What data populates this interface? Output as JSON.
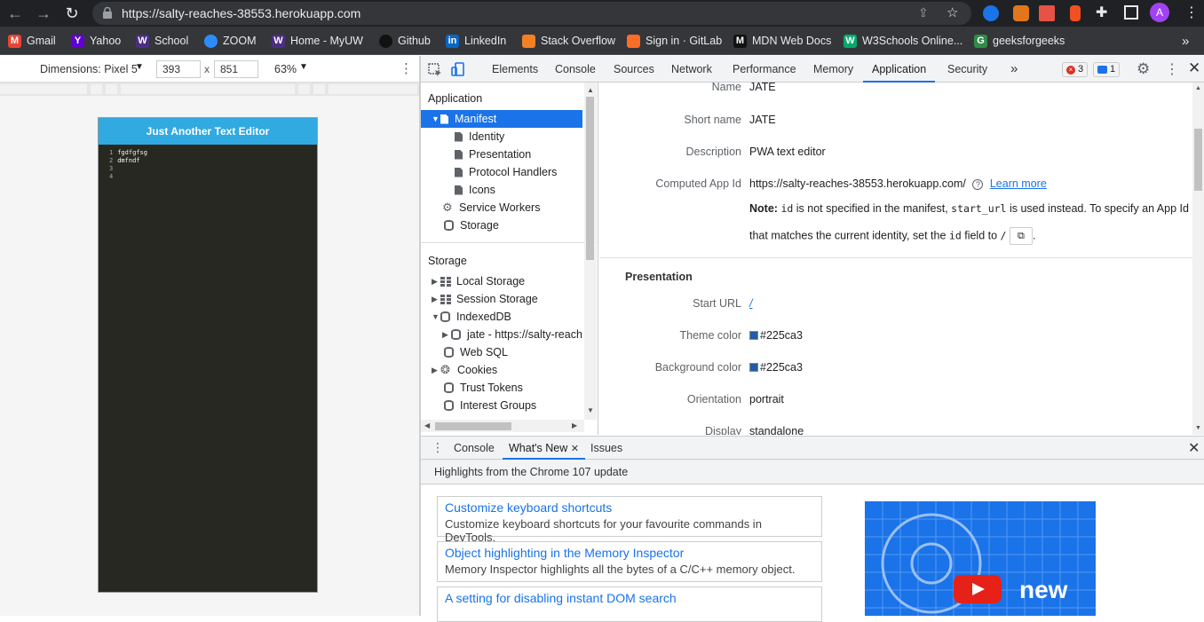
{
  "browser": {
    "url": "https://salty-reaches-38553.herokuapp.com",
    "profile_initial": "A",
    "bookmarks": [
      "Gmail",
      "Yahoo",
      "School",
      "ZOOM",
      "Home - MyUW",
      "Github",
      "LinkedIn",
      "Stack Overflow",
      "Sign in · GitLab",
      "MDN Web Docs",
      "W3Schools Online...",
      "geeksforgeeks"
    ],
    "more_label": "»"
  },
  "device_toolbar": {
    "dimensions_label": "Dimensions: Pixel 5",
    "width": "393",
    "height": "851",
    "separator": "x",
    "zoom": "63%"
  },
  "app": {
    "title": "Just Another Text Editor",
    "lines": [
      {
        "n": "1",
        "text": "fgdfgfsg"
      },
      {
        "n": "2",
        "text": "dmfndf"
      },
      {
        "n": "3",
        "text": ""
      },
      {
        "n": "4",
        "text": ""
      }
    ]
  },
  "devtools": {
    "tabs": [
      "Elements",
      "Console",
      "Sources",
      "Network",
      "Performance",
      "Memory",
      "Application",
      "Security"
    ],
    "active_tab": "Application",
    "more_tabs": "»",
    "errors_count": "3",
    "messages_count": "1",
    "sidebar": {
      "application_heading": "Application",
      "manifest": "Manifest",
      "manifest_children": [
        "Identity",
        "Presentation",
        "Protocol Handlers",
        "Icons"
      ],
      "service_workers": "Service Workers",
      "storage_item": "Storage",
      "storage_heading": "Storage",
      "local_storage": "Local Storage",
      "session_storage": "Session Storage",
      "indexeddb": "IndexedDB",
      "indexeddb_child": "jate - https://salty-reach",
      "web_sql": "Web SQL",
      "cookies": "Cookies",
      "trust_tokens": "Trust Tokens",
      "interest_groups": "Interest Groups"
    },
    "manifest": {
      "name_label": "Name",
      "name": "JATE",
      "short_name_label": "Short name",
      "short_name": "JATE",
      "description_label": "Description",
      "description": "PWA text editor",
      "app_id_label": "Computed App Id",
      "app_id": "https://salty-reaches-38553.herokuapp.com/",
      "learn_more": "Learn more",
      "note_bold": "Note:",
      "note_code1": "id",
      "note_text1": " is not specified in the manifest, ",
      "note_code2": "start_url",
      "note_text2": " is used instead. To specify an App Id",
      "note_line2_a": "that matches the current identity, set the ",
      "note_code3": "id",
      "note_line2_b": " field to ",
      "note_code4": "/",
      "note_end": ".",
      "presentation_heading": "Presentation",
      "start_url_label": "Start URL",
      "start_url": "/",
      "theme_color_label": "Theme color",
      "theme_color": "#225ca3",
      "bg_color_label": "Background color",
      "bg_color": "#225ca3",
      "orientation_label": "Orientation",
      "orientation": "portrait",
      "display_label": "Display",
      "display": "standalone"
    },
    "drawer": {
      "tabs": [
        "Console",
        "What's New",
        "Issues"
      ],
      "active_tab": "What's New",
      "highlights": "Highlights from the Chrome 107 update",
      "cards": [
        {
          "title": "Customize keyboard shortcuts",
          "desc": "Customize keyboard shortcuts for your favourite commands in DevTools."
        },
        {
          "title": "Object highlighting in the Memory Inspector",
          "desc": "Memory Inspector highlights all the bytes of a C/C++ memory object."
        },
        {
          "title": "A setting for disabling instant DOM search",
          "desc": ""
        }
      ],
      "video_word": "new"
    }
  }
}
